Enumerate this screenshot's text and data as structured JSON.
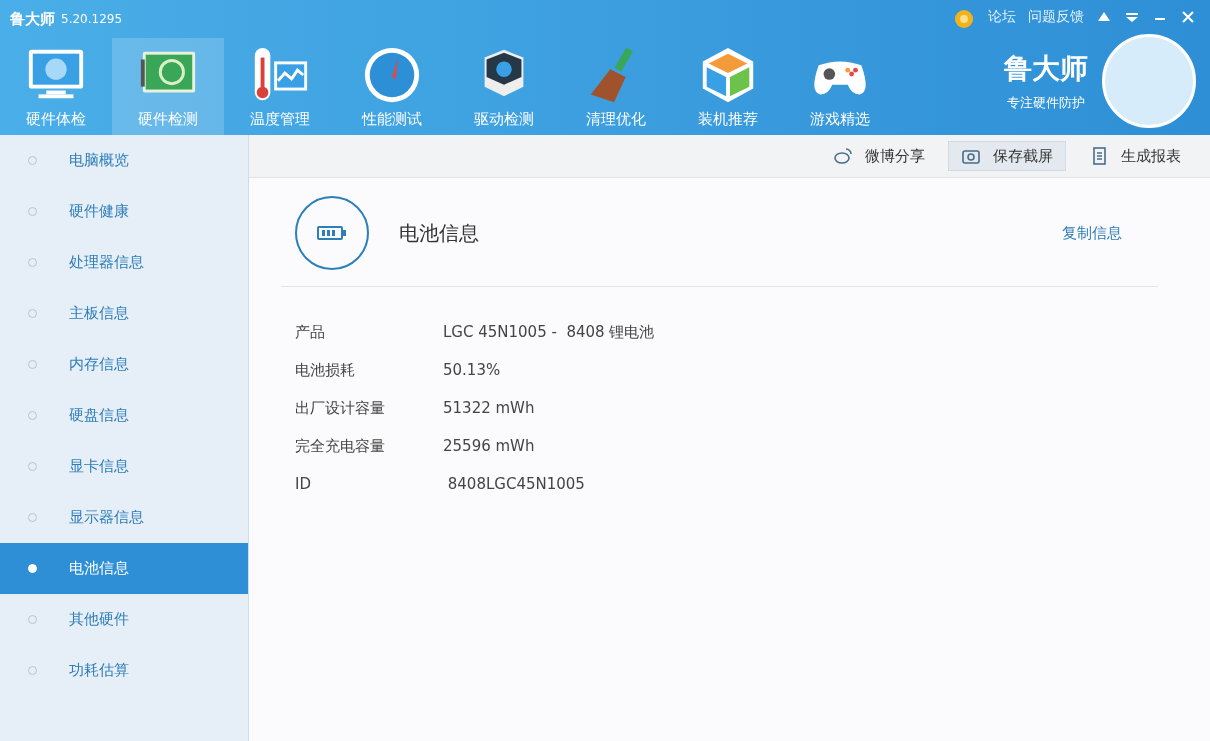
{
  "app": {
    "title": "鲁大师",
    "version": "5.20.1295"
  },
  "top_links": [
    "论坛",
    "问题反馈"
  ],
  "nav": [
    {
      "label": "硬件体检",
      "selected": false
    },
    {
      "label": "硬件检测",
      "selected": true
    },
    {
      "label": "温度管理",
      "selected": false
    },
    {
      "label": "性能测试",
      "selected": false
    },
    {
      "label": "驱动检测",
      "selected": false
    },
    {
      "label": "清理优化",
      "selected": false
    },
    {
      "label": "装机推荐",
      "selected": false
    },
    {
      "label": "游戏精选",
      "selected": false
    }
  ],
  "brand": {
    "name": "鲁大师",
    "slogan": "专注硬件防护"
  },
  "sidebar": [
    {
      "label": "电脑概览",
      "selected": false
    },
    {
      "label": "硬件健康",
      "selected": false
    },
    {
      "label": "处理器信息",
      "selected": false
    },
    {
      "label": "主板信息",
      "selected": false
    },
    {
      "label": "内存信息",
      "selected": false
    },
    {
      "label": "硬盘信息",
      "selected": false
    },
    {
      "label": "显卡信息",
      "selected": false
    },
    {
      "label": "显示器信息",
      "selected": false
    },
    {
      "label": "电池信息",
      "selected": true
    },
    {
      "label": "其他硬件",
      "selected": false
    },
    {
      "label": "功耗估算",
      "selected": false
    }
  ],
  "actions": [
    {
      "label": "微博分享",
      "selected": false
    },
    {
      "label": "保存截屏",
      "selected": true
    },
    {
      "label": "生成报表",
      "selected": false
    }
  ],
  "panel": {
    "title": "电池信息",
    "copy_link": "复制信息",
    "rows": [
      {
        "label": "产品",
        "value": "LGC 45N1005 -  8408 锂电池"
      },
      {
        "label": "电池损耗",
        "value": "50.13%"
      },
      {
        "label": "出厂设计容量",
        "value": "51322 mWh"
      },
      {
        "label": "完全充电容量",
        "value": "25596 mWh"
      },
      {
        "label": "ID",
        "value": " 8408LGC45N1005"
      }
    ]
  }
}
